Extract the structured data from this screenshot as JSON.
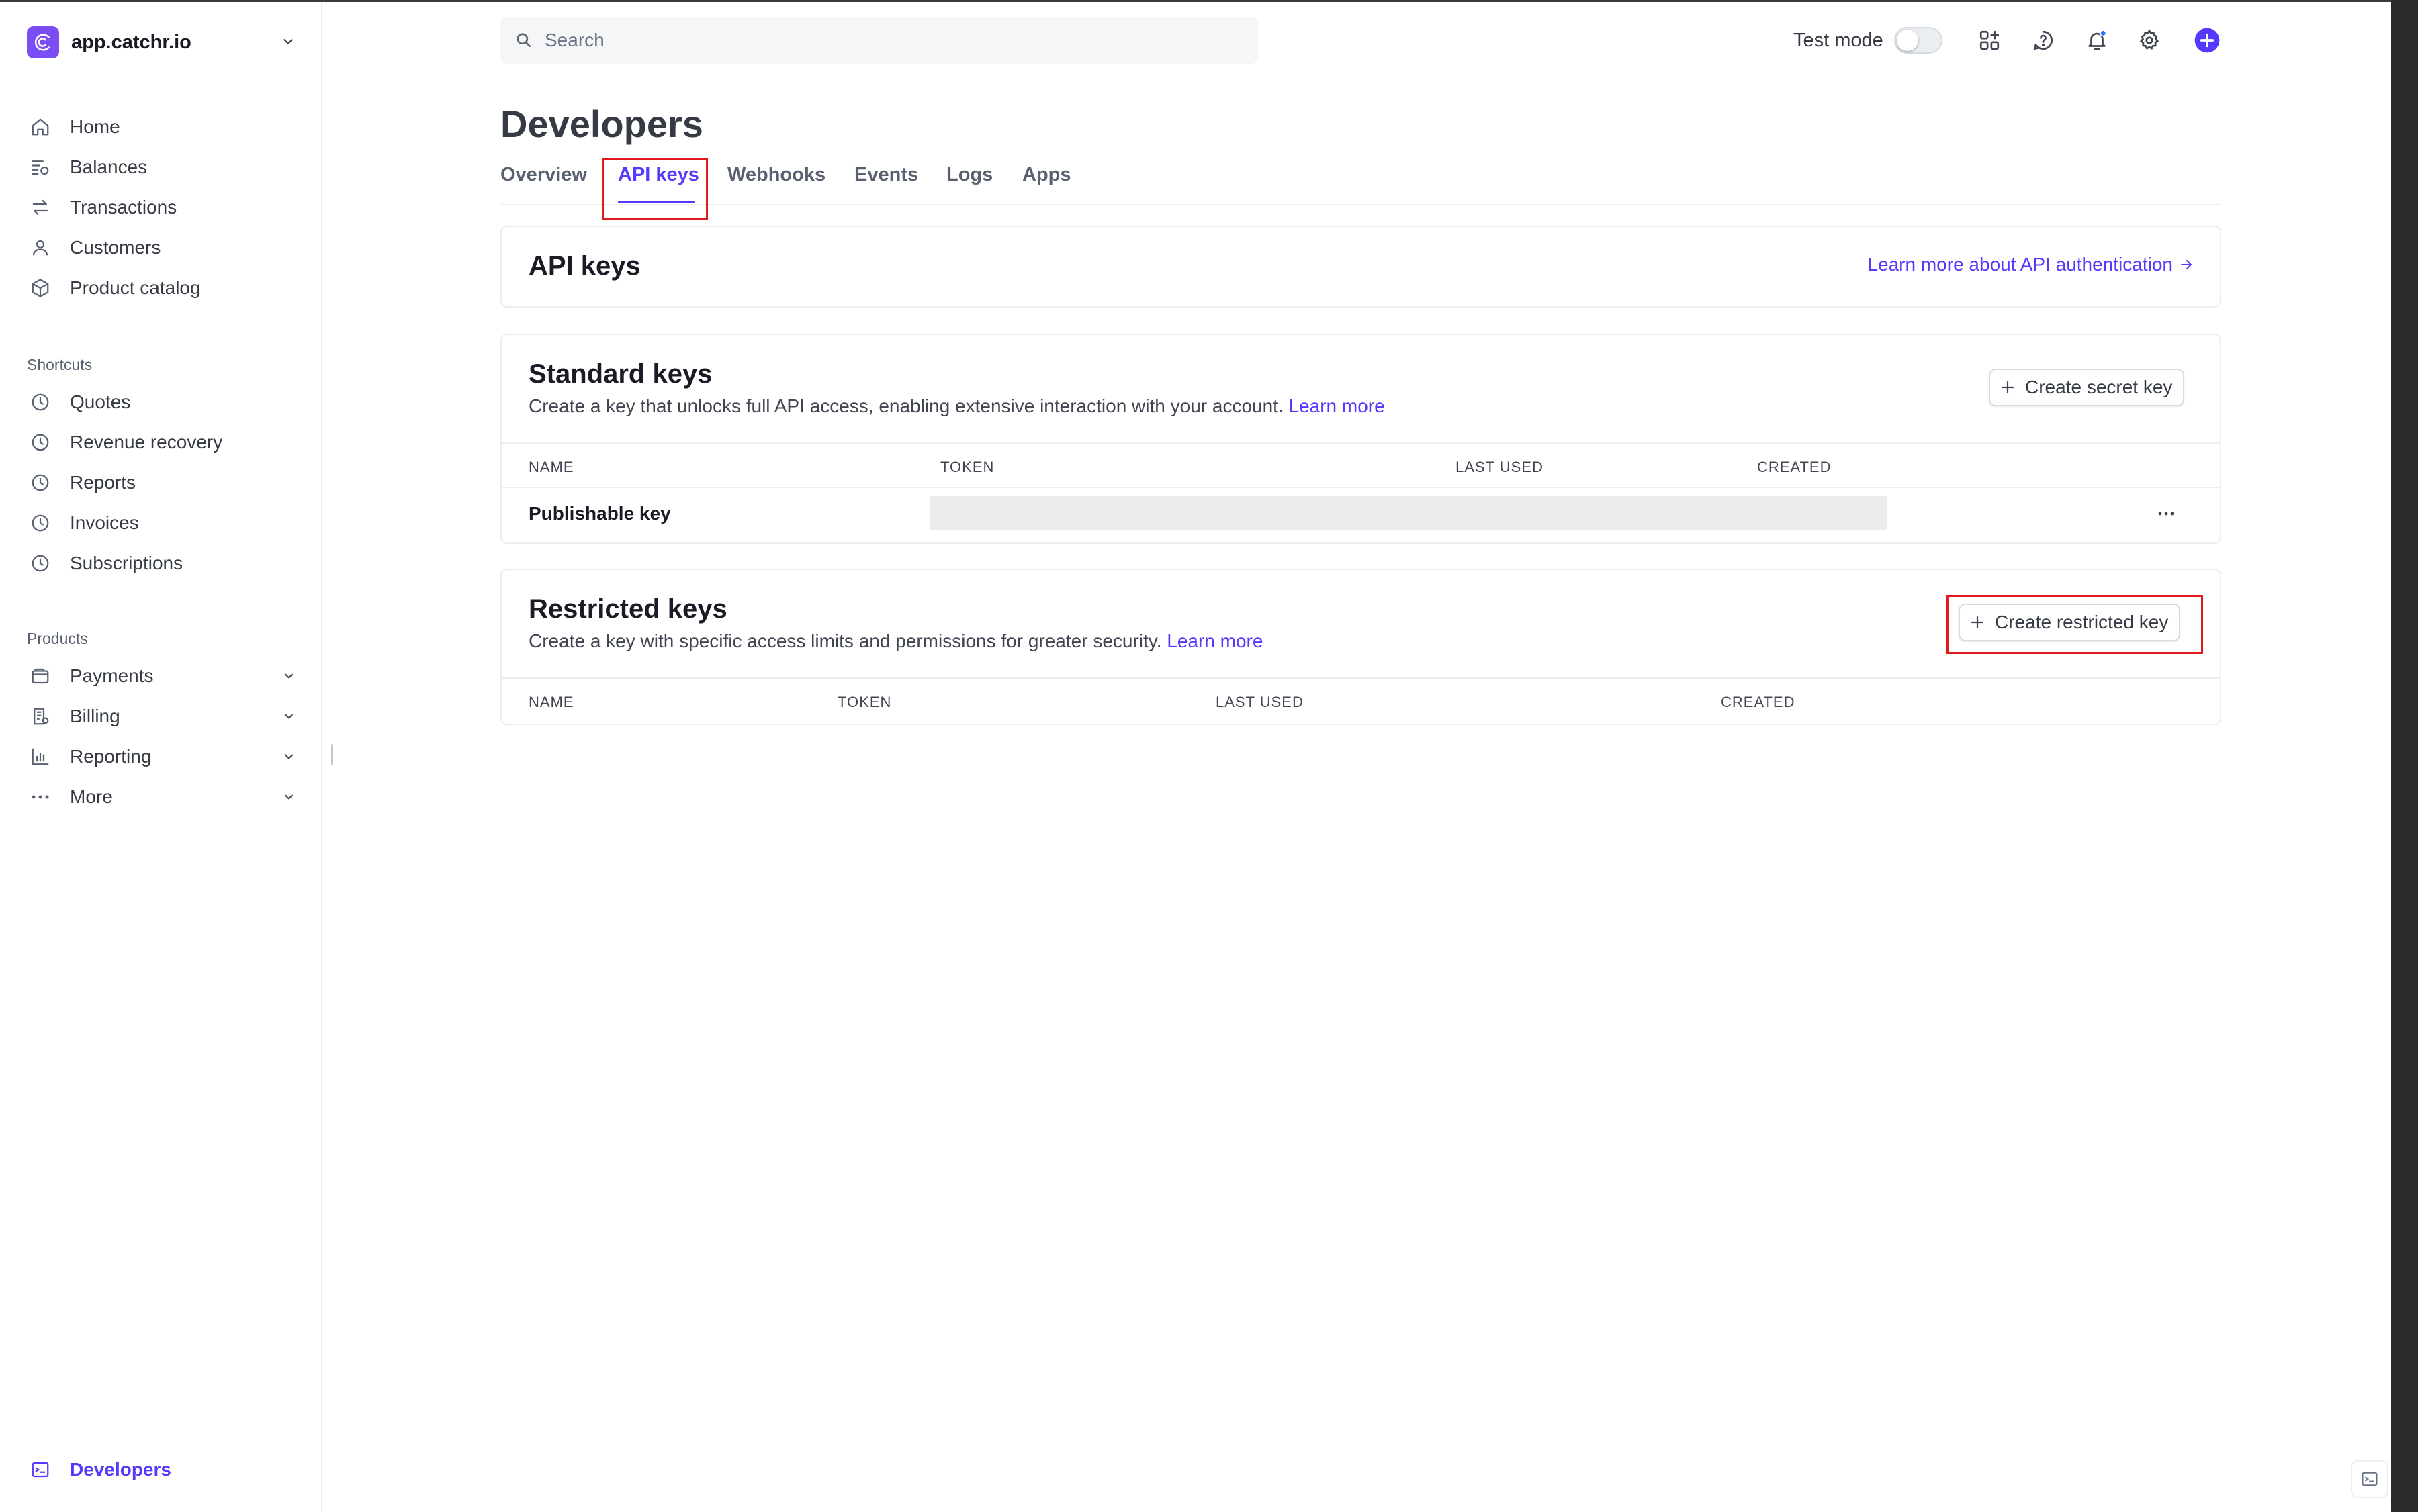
{
  "brand": {
    "name": "app.catchr.io",
    "accent": "#7a4df5"
  },
  "sidebar": {
    "main_items": [
      {
        "label": "Home",
        "icon": "home-icon"
      },
      {
        "label": "Balances",
        "icon": "balances-icon"
      },
      {
        "label": "Transactions",
        "icon": "transactions-icon"
      },
      {
        "label": "Customers",
        "icon": "customers-icon"
      },
      {
        "label": "Product catalog",
        "icon": "box-icon"
      }
    ],
    "shortcuts_label": "Shortcuts",
    "shortcuts": [
      {
        "label": "Quotes",
        "icon": "clock-icon"
      },
      {
        "label": "Revenue recovery",
        "icon": "clock-icon"
      },
      {
        "label": "Reports",
        "icon": "clock-icon"
      },
      {
        "label": "Invoices",
        "icon": "clock-icon"
      },
      {
        "label": "Subscriptions",
        "icon": "clock-icon"
      }
    ],
    "products_label": "Products",
    "products": [
      {
        "label": "Payments",
        "icon": "wallet-icon"
      },
      {
        "label": "Billing",
        "icon": "billing-icon"
      },
      {
        "label": "Reporting",
        "icon": "bar-chart-icon"
      },
      {
        "label": "More",
        "icon": "more-dots-icon"
      }
    ],
    "bottom_item": {
      "label": "Developers",
      "icon": "terminal-icon"
    }
  },
  "topbar": {
    "search_placeholder": "Search",
    "test_mode_label": "Test mode",
    "test_mode_on": false,
    "icons": [
      "apps-plus-icon",
      "help-icon",
      "notifications-icon",
      "settings-icon",
      "create-plus-icon"
    ]
  },
  "page": {
    "title": "Developers",
    "tabs": [
      "Overview",
      "API keys",
      "Webhooks",
      "Events",
      "Logs",
      "Apps"
    ],
    "active_tab": "API keys"
  },
  "api_keys_card": {
    "title": "API keys",
    "learn_more_link": "Learn more about API authentication"
  },
  "standard_keys": {
    "title": "Standard keys",
    "description": "Create a key that unlocks full API access, enabling extensive interaction with your account.",
    "learn_more": "Learn more",
    "create_button": "Create secret key",
    "columns": [
      "NAME",
      "TOKEN",
      "LAST USED",
      "CREATED"
    ],
    "rows": [
      {
        "name": "Publishable key",
        "token": "",
        "last_used": "",
        "created": ""
      }
    ]
  },
  "restricted_keys": {
    "title": "Restricted keys",
    "description": "Create a key with specific access limits and permissions for greater security.",
    "learn_more": "Learn more",
    "create_button": "Create restricted key",
    "columns": [
      "NAME",
      "TOKEN",
      "LAST USED",
      "CREATED"
    ]
  },
  "colors": {
    "accent": "#533afd",
    "highlight_box": "#df1b1b",
    "notification_dot": "#2970ff"
  }
}
